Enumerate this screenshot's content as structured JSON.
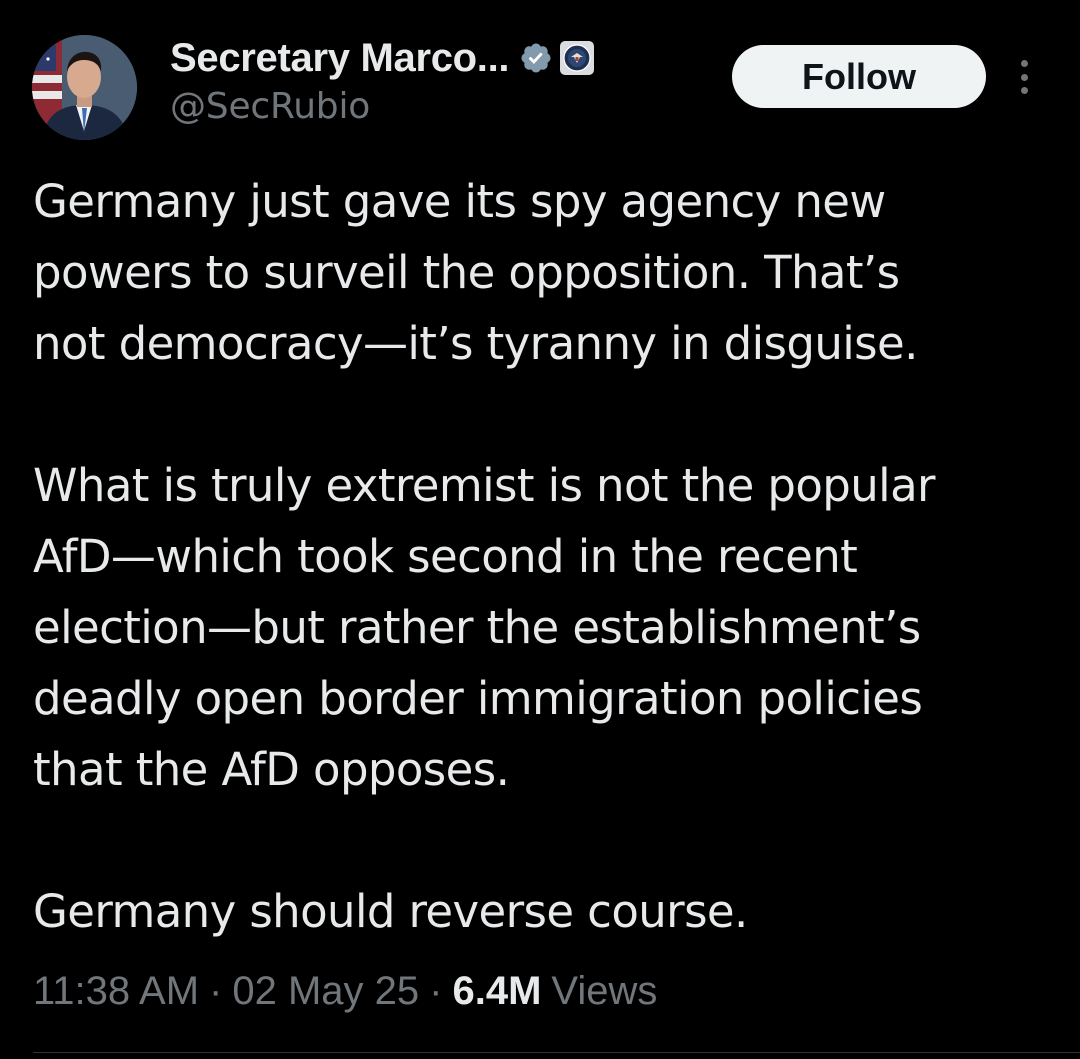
{
  "author": {
    "display_name": "Secretary Marco...",
    "handle": "@SecRubio",
    "verified_badge_icon": "verified-badge-icon",
    "affiliation_icon": "state-department-seal-icon"
  },
  "actions": {
    "follow_label": "Follow",
    "more_icon": "more-options-icon"
  },
  "tweet": {
    "paragraphs": [
      [
        "Germany just gave its spy agency new",
        "powers to surveil the opposition.  That’s",
        "not democracy—it’s tyranny in disguise."
      ],
      [
        "What is truly extremist is not the popular",
        "AfD—which took second in the recent",
        "election—but rather the establishment’s",
        "deadly open border immigration policies",
        "that the AfD opposes."
      ],
      [
        "Germany should reverse course."
      ]
    ]
  },
  "meta": {
    "time": "11:38 AM",
    "separator": "·",
    "date": "02 May 25",
    "views_count": "6.4M",
    "views_label": "Views"
  },
  "colors": {
    "background": "#000000",
    "text_primary": "#e7e9ea",
    "text_secondary": "#71767b",
    "verified_badge": "#829aab",
    "follow_button_bg": "#eff3f4"
  }
}
